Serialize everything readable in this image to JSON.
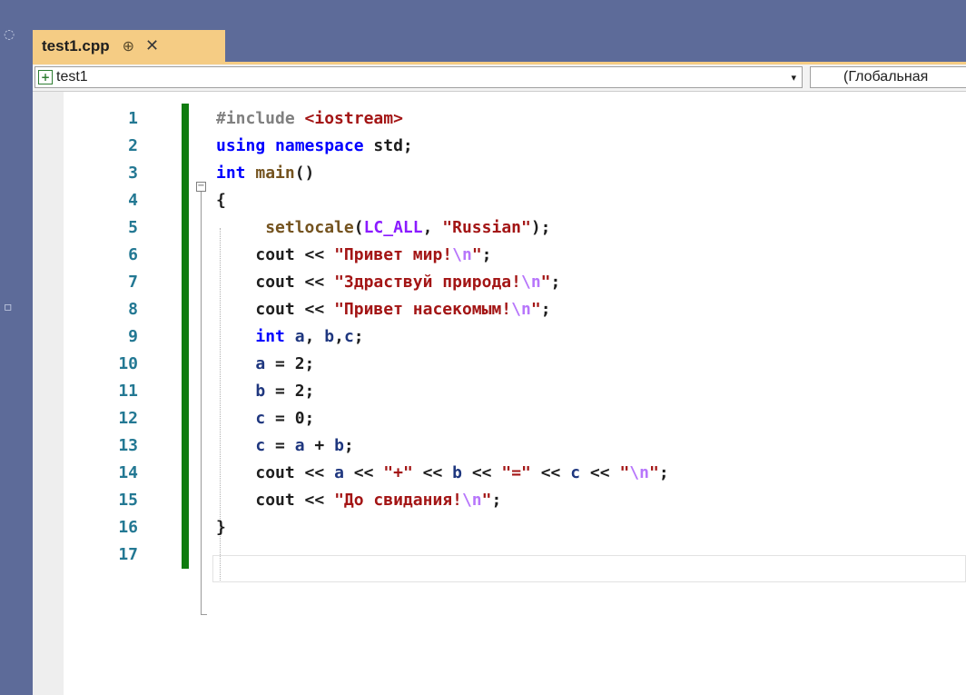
{
  "tab": {
    "title": "test1.cpp",
    "pin_glyph": "⊕",
    "close_glyph": "✕"
  },
  "navigation": {
    "project_icon": "+",
    "project": "test1",
    "dropdown_glyph": "▾",
    "scope": "(Глобальная"
  },
  "editor": {
    "line_numbers": [
      "1",
      "2",
      "3",
      "4",
      "5",
      "6",
      "7",
      "8",
      "9",
      "10",
      "11",
      "12",
      "13",
      "14",
      "15",
      "16",
      "17"
    ],
    "fold_glyph": "−",
    "lines": [
      {
        "indent": "",
        "tokens": [
          {
            "t": "#include ",
            "c": "inc"
          },
          {
            "t": "<iostream>",
            "c": "hdr"
          }
        ]
      },
      {
        "indent": "",
        "tokens": [
          {
            "t": "using",
            "c": "kw"
          },
          {
            "t": " ",
            "c": ""
          },
          {
            "t": "namespace",
            "c": "kw"
          },
          {
            "t": " std;",
            "c": ""
          }
        ]
      },
      {
        "indent": "",
        "tokens": [
          {
            "t": "int",
            "c": "kw"
          },
          {
            "t": " ",
            "c": ""
          },
          {
            "t": "main",
            "c": "fn"
          },
          {
            "t": "()",
            "c": ""
          }
        ]
      },
      {
        "indent": "",
        "tokens": [
          {
            "t": "{",
            "c": ""
          }
        ]
      },
      {
        "indent": "     ",
        "tokens": [
          {
            "t": "setlocale",
            "c": "fn"
          },
          {
            "t": "(",
            "c": ""
          },
          {
            "t": "LC_ALL",
            "c": "mac"
          },
          {
            "t": ", ",
            "c": ""
          },
          {
            "t": "\"Russian\"",
            "c": "str"
          },
          {
            "t": ");",
            "c": ""
          }
        ]
      },
      {
        "indent": "    ",
        "tokens": [
          {
            "t": "cout",
            "c": ""
          },
          {
            "t": " << ",
            "c": ""
          },
          {
            "t": "\"Привет мир!",
            "c": "str"
          },
          {
            "t": "\\n",
            "c": "esc"
          },
          {
            "t": "\"",
            "c": "str"
          },
          {
            "t": ";",
            "c": ""
          }
        ]
      },
      {
        "indent": "    ",
        "tokens": [
          {
            "t": "cout",
            "c": ""
          },
          {
            "t": " << ",
            "c": ""
          },
          {
            "t": "\"Здраствуй природа!",
            "c": "str"
          },
          {
            "t": "\\n",
            "c": "esc"
          },
          {
            "t": "\"",
            "c": "str"
          },
          {
            "t": ";",
            "c": ""
          }
        ]
      },
      {
        "indent": "    ",
        "tokens": [
          {
            "t": "cout",
            "c": ""
          },
          {
            "t": " << ",
            "c": ""
          },
          {
            "t": "\"Привет насекомым!",
            "c": "str"
          },
          {
            "t": "\\n",
            "c": "esc"
          },
          {
            "t": "\"",
            "c": "str"
          },
          {
            "t": ";",
            "c": ""
          }
        ]
      },
      {
        "indent": "    ",
        "tokens": [
          {
            "t": "int",
            "c": "kw"
          },
          {
            "t": " ",
            "c": ""
          },
          {
            "t": "a",
            "c": "var"
          },
          {
            "t": ", ",
            "c": ""
          },
          {
            "t": "b",
            "c": "var"
          },
          {
            "t": ",",
            "c": ""
          },
          {
            "t": "c",
            "c": "var"
          },
          {
            "t": ";",
            "c": ""
          }
        ]
      },
      {
        "indent": "    ",
        "tokens": [
          {
            "t": "a",
            "c": "var"
          },
          {
            "t": " = 2;",
            "c": ""
          }
        ]
      },
      {
        "indent": "    ",
        "tokens": [
          {
            "t": "b",
            "c": "var"
          },
          {
            "t": " = 2;",
            "c": ""
          }
        ]
      },
      {
        "indent": "    ",
        "tokens": [
          {
            "t": "c",
            "c": "var"
          },
          {
            "t": " = 0;",
            "c": ""
          }
        ]
      },
      {
        "indent": "    ",
        "tokens": [
          {
            "t": "c",
            "c": "var"
          },
          {
            "t": " = ",
            "c": ""
          },
          {
            "t": "a",
            "c": "var"
          },
          {
            "t": " + ",
            "c": ""
          },
          {
            "t": "b",
            "c": "var"
          },
          {
            "t": ";",
            "c": ""
          }
        ]
      },
      {
        "indent": "    ",
        "tokens": [
          {
            "t": "cout",
            "c": ""
          },
          {
            "t": " << ",
            "c": ""
          },
          {
            "t": "a",
            "c": "var"
          },
          {
            "t": " << ",
            "c": ""
          },
          {
            "t": "\"+\"",
            "c": "str"
          },
          {
            "t": " << ",
            "c": ""
          },
          {
            "t": "b",
            "c": "var"
          },
          {
            "t": " << ",
            "c": ""
          },
          {
            "t": "\"=\"",
            "c": "str"
          },
          {
            "t": " << ",
            "c": ""
          },
          {
            "t": "c",
            "c": "var"
          },
          {
            "t": " << ",
            "c": ""
          },
          {
            "t": "\"",
            "c": "str"
          },
          {
            "t": "\\n",
            "c": "esc"
          },
          {
            "t": "\"",
            "c": "str"
          },
          {
            "t": ";",
            "c": ""
          }
        ]
      },
      {
        "indent": "    ",
        "tokens": [
          {
            "t": "cout",
            "c": ""
          },
          {
            "t": " << ",
            "c": ""
          },
          {
            "t": "\"До свидания!",
            "c": "str"
          },
          {
            "t": "\\n",
            "c": "esc"
          },
          {
            "t": "\"",
            "c": "str"
          },
          {
            "t": ";",
            "c": ""
          }
        ]
      },
      {
        "indent": "",
        "tokens": [
          {
            "t": "}",
            "c": ""
          }
        ]
      },
      {
        "indent": "",
        "tokens": []
      }
    ]
  },
  "colors": {
    "keyword": "#0000ff",
    "string": "#a31515",
    "escape": "#b776fb",
    "line_number": "#237893",
    "change_bar": "#107c10",
    "tab_active": "#f5cc84",
    "chrome": "#5d6b99"
  }
}
